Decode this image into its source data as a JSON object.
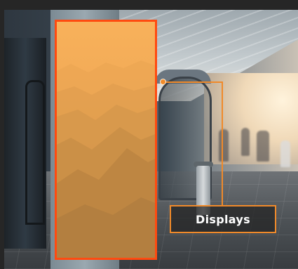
{
  "callout": {
    "label": "Displays"
  },
  "colors": {
    "accent": "#f08a2a",
    "display_border": "#ff4a10",
    "display_fill": "#f4ad57"
  }
}
